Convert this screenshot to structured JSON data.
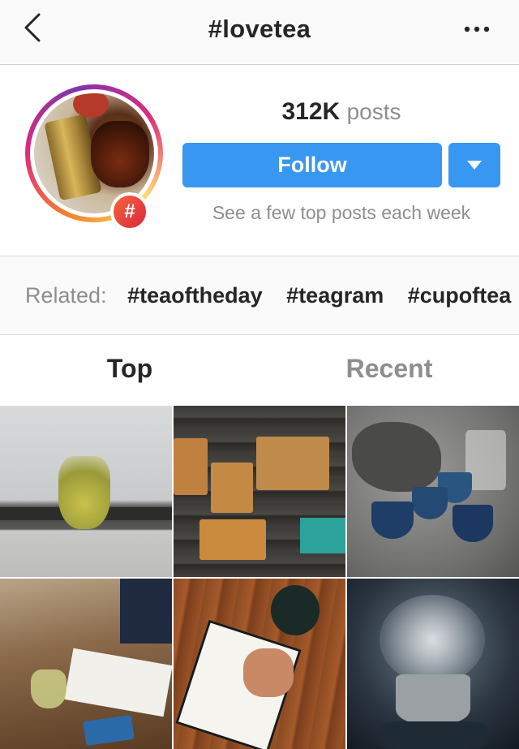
{
  "header": {
    "title": "#lovetea",
    "back_icon": "chevron-left-icon",
    "more_icon": "ellipsis-icon"
  },
  "profile": {
    "post_count": "312K",
    "post_label": "posts",
    "hash_symbol": "#",
    "follow_label": "Follow",
    "subtitle": "See a few top posts each week"
  },
  "related": {
    "label": "Related:",
    "tags": [
      "#teaoftheday",
      "#teagram",
      "#cupoftea"
    ]
  },
  "tabs": [
    {
      "label": "Top",
      "active": true
    },
    {
      "label": "Recent",
      "active": false
    }
  ],
  "colors": {
    "follow_blue": "#3897f0",
    "text_dark": "#262626",
    "text_gray": "#8e8e8e",
    "header_bg": "#fafafa",
    "hash_badge": "#e84a3c"
  }
}
